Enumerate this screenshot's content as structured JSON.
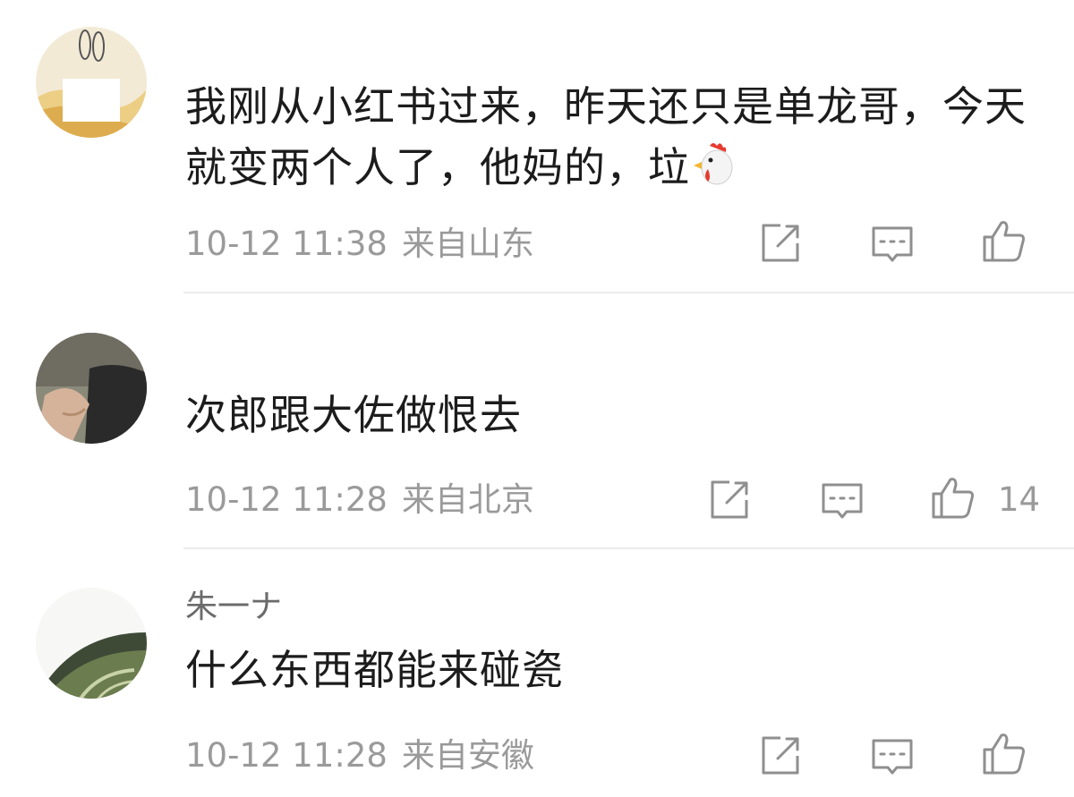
{
  "comments": [
    {
      "username": "",
      "text": "我刚从小红书过来，昨天还只是单龙哥，今天就变两个人了，他妈的，垃",
      "emoji": "rooster-emoji",
      "time": "10-12 11:38",
      "location": "来自山东",
      "likes": ""
    },
    {
      "username": "",
      "text": "次郎跟大佐做恨去",
      "time": "10-12 11:28",
      "location": "来自北京",
      "likes": "14"
    },
    {
      "username": "朱一ナ",
      "text": "什么东西都能来碰瓷",
      "time": "10-12 11:28",
      "location": "来自安徽",
      "likes": ""
    }
  ],
  "icons": {
    "share": "share-icon",
    "reply": "comment-icon",
    "like": "thumbs-up-icon"
  },
  "colors": {
    "text": "#1c1c1c",
    "meta": "#9a9a9a",
    "username": "#6b6b6b",
    "icon": "#8f8f8f",
    "divider": "#ececec"
  }
}
